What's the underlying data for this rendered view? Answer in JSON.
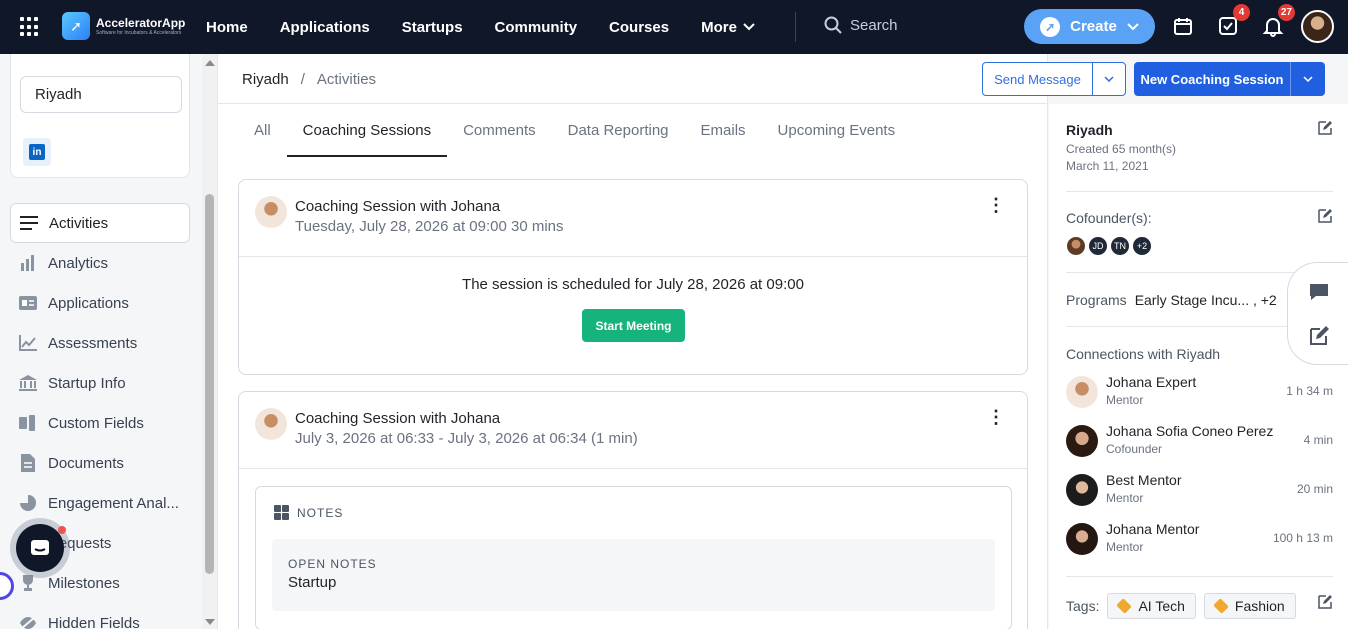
{
  "topbar": {
    "logo_name": "AcceleratorApp",
    "logo_sub": "Software for Incubators & Accelerators",
    "nav": [
      "Home",
      "Applications",
      "Startups",
      "Community",
      "Courses",
      "More"
    ],
    "search_placeholder": "Search",
    "create_label": "Create",
    "tasks_badge": "4",
    "notifications_badge": "27"
  },
  "sidebar": {
    "profile_name": "Riyadh",
    "menu": [
      {
        "label": "Activities",
        "icon": "list-icon"
      },
      {
        "label": "Analytics",
        "icon": "bar-chart-icon"
      },
      {
        "label": "Applications",
        "icon": "id-card-icon"
      },
      {
        "label": "Assessments",
        "icon": "line-chart-icon"
      },
      {
        "label": "Startup Info",
        "icon": "bank-icon"
      },
      {
        "label": "Custom Fields",
        "icon": "custom-fields-icon"
      },
      {
        "label": "Documents",
        "icon": "document-icon"
      },
      {
        "label": "Engagement Anal...",
        "icon": "pie-chart-icon"
      },
      {
        "label": "Requests",
        "icon": "request-icon"
      },
      {
        "label": "Milestones",
        "icon": "trophy-icon"
      },
      {
        "label": "Hidden Fields",
        "icon": "eye-off-icon"
      }
    ]
  },
  "breadcrumb": {
    "first": "Riyadh",
    "sep": "/",
    "current": "Activities"
  },
  "actions": {
    "send_message": "Send Message",
    "new_session": "New Coaching Session"
  },
  "tabs": [
    "All",
    "Coaching Sessions",
    "Comments",
    "Data Reporting",
    "Emails",
    "Upcoming Events"
  ],
  "sessions": [
    {
      "title": "Coaching Session with Johana",
      "subtitle": "Tuesday, July 28, 2026 at 09:00 30 mins",
      "scheduled_text": "The session is scheduled for July 28, 2026 at 09:00",
      "button": "Start Meeting"
    },
    {
      "title": "Coaching Session with Johana",
      "subtitle": "July 3, 2026 at 06:33 - July 3, 2026 at 06:34 (1 min)",
      "notes_label": "NOTES",
      "open_notes_title": "OPEN NOTES",
      "open_notes_value": "Startup"
    }
  ],
  "right_panel": {
    "name": "Riyadh",
    "created": "Created 65 month(s)",
    "date": "March 11, 2021",
    "cofounders_label": "Cofounder(s):",
    "cofounders": [
      "JD",
      "TN",
      "+2"
    ],
    "programs_label": "Programs",
    "programs_value": "Early Stage Incu... , +2",
    "connections_label": "Connections with Riyadh",
    "connections": [
      {
        "name": "Johana Expert",
        "role": "Mentor",
        "time": "1 h 34 m"
      },
      {
        "name": "Johana Sofia Coneo Perez",
        "role": "Cofounder",
        "time": "4 min"
      },
      {
        "name": "Best Mentor",
        "role": "Mentor",
        "time": "20 min"
      },
      {
        "name": "Johana Mentor",
        "role": "Mentor",
        "time": "100 h 13 m"
      }
    ],
    "tags_label": "Tags:",
    "tags": [
      "AI Tech",
      "Fashion"
    ]
  }
}
